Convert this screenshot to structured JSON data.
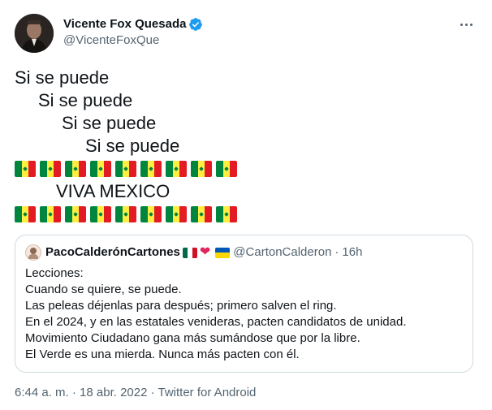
{
  "author": {
    "display_name": "Vicente Fox Quesada",
    "handle": "@VicenteFoxQue",
    "verified": true
  },
  "tweet": {
    "lines": [
      {
        "text": "Si se puede",
        "indent": 0
      },
      {
        "text": "Si se puede",
        "indent": 1
      },
      {
        "text": "Si se puede",
        "indent": 2
      },
      {
        "text": "Si se puede",
        "indent": 3
      }
    ],
    "flag_row_count": 9,
    "flag_icon": "flag-senegal-icon",
    "shout": "VIVA MEXICO"
  },
  "quoted": {
    "display_name": "PacoCalderónCartones",
    "handle": "@CartonCalderon",
    "separator": "·",
    "time": "16h",
    "lines": [
      "Lecciones:",
      "Cuando se quiere, se puede.",
      "Las peleas déjenlas para después; primero salven el ring.",
      "En el 2024, y en las estatales venideras, pacten candidatos de unidad.",
      "Movimiento Ciudadano gana más sumándose que por la libre.",
      "El Verde es una mierda. Nunca más pacten con él."
    ]
  },
  "meta": {
    "timestamp": "6:44 a. m. · 18 abr. 2022 · Twitter for Android"
  },
  "colors": {
    "text": "#0f1419",
    "secondary": "#536471",
    "verified": "#1d9bf0",
    "border": "#cfd9de"
  }
}
